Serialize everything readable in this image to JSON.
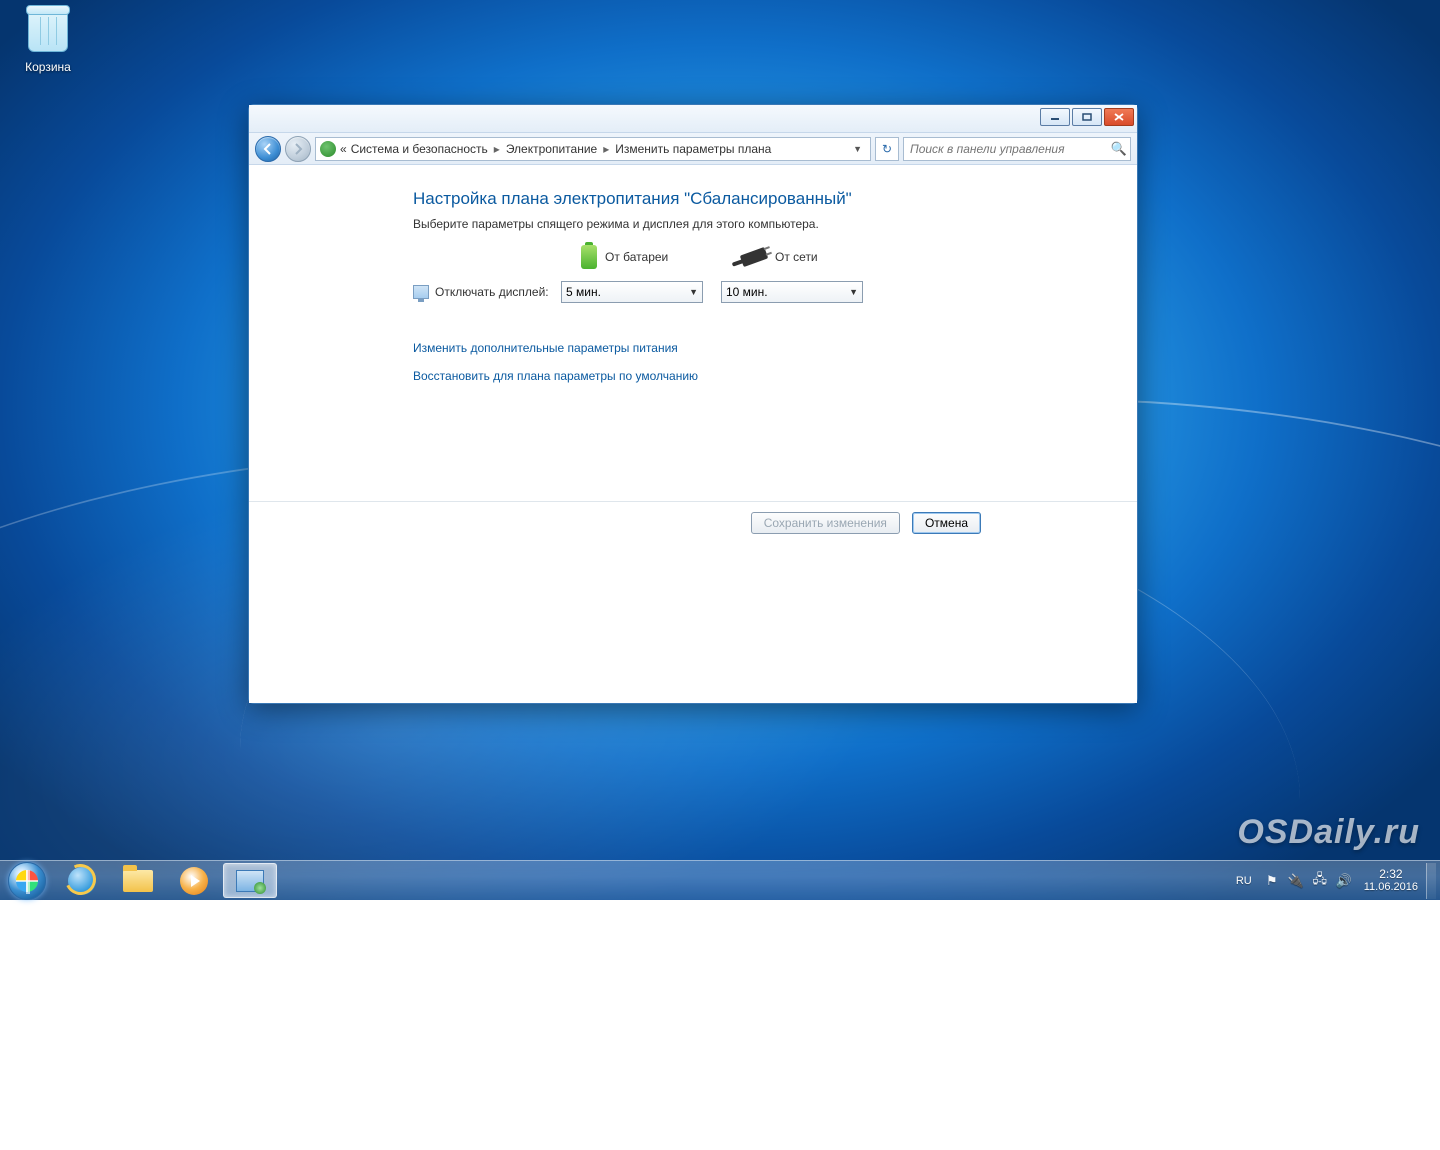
{
  "desktop": {
    "recycle_bin_label": "Корзина"
  },
  "watermark": "OSDaily.ru",
  "window": {
    "breadcrumb": {
      "lvl1": "Система и безопасность",
      "lvl2": "Электропитание",
      "lvl3": "Изменить параметры плана"
    },
    "search_placeholder": "Поиск в панели управления",
    "heading": "Настройка плана электропитания \"Сбалансированный\"",
    "subtext": "Выберите параметры спящего режима и дисплея для этого компьютера.",
    "col_battery": "От батареи",
    "col_ac": "От сети",
    "row_display_off": "Отключать дисплей:",
    "display_off_battery": "5 мин.",
    "display_off_ac": "10 мин.",
    "link_advanced": "Изменить дополнительные параметры питания",
    "link_restore": "Восстановить для плана параметры по умолчанию",
    "btn_save": "Сохранить изменения",
    "btn_cancel": "Отмена"
  },
  "taskbar": {
    "lang": "RU",
    "time": "2:32",
    "date": "11.06.2016"
  }
}
